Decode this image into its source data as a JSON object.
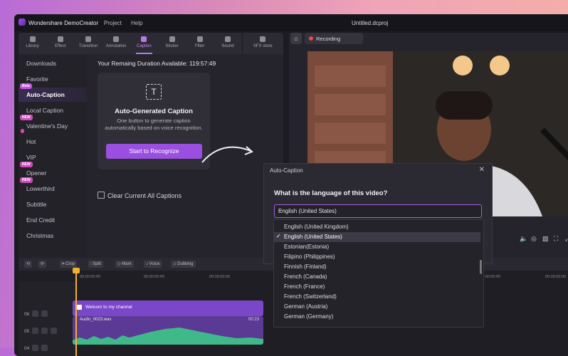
{
  "titlebar": {
    "brand": "Wondershare DemoCreator",
    "menu_project": "Project",
    "menu_help": "Help",
    "file": "Untitled.dcproj"
  },
  "tabs": [
    "Library",
    "Effect",
    "Transition",
    "Annotation",
    "Caption",
    "Sticker",
    "Filter",
    "Sound",
    "SFX store"
  ],
  "active_tab": "Caption",
  "sidebar": {
    "items": [
      {
        "label": "Downloads",
        "badge": ""
      },
      {
        "label": "Favorite",
        "badge": ""
      },
      {
        "label": "Auto-Caption",
        "badge": "Beta"
      },
      {
        "label": "Local Caption",
        "badge": ""
      },
      {
        "label": "Valentine's Day",
        "badge": "NEW"
      },
      {
        "label": "Hot",
        "badge": ""
      },
      {
        "label": "VIP",
        "badge": ""
      },
      {
        "label": "Opener",
        "badge": "NEW"
      },
      {
        "label": "Lowerthird",
        "badge": "NEW"
      },
      {
        "label": "Subtitle",
        "badge": ""
      },
      {
        "label": "End Credit",
        "badge": ""
      },
      {
        "label": "Christmas",
        "badge": ""
      }
    ]
  },
  "caption_panel": {
    "remaining": "Your Remaing Duration Available: 119:57:49",
    "card_title": "Auto-Generated Caption",
    "card_desc": "One button to generate caption automatically based on voice recognition.",
    "start_button": "Start to Recognize",
    "clear_label": "Clear Current All Captions"
  },
  "preview": {
    "recording_label": "Recording"
  },
  "dialog": {
    "title": "Auto-Caption",
    "question": "What is the language of this video?",
    "selected": "English (United States)",
    "options": [
      "English (United Kingdom)",
      "English (United States)",
      "Estonian(Estonia)",
      "Filipino (Philippines)",
      "Finnish (Finland)",
      "French (Canada)",
      "French (France)",
      "French (Switzerland)",
      "German (Austria)",
      "German (Germany)"
    ]
  },
  "timeline": {
    "tools": [
      "Crop",
      "Split",
      "Mark",
      "Voice",
      "Dubbing"
    ],
    "ruler": [
      "00:00:00:00",
      "00:00:00:00",
      "00:00:00:00",
      "00:00:00:00",
      "00:00:00:00"
    ],
    "tracks": [
      "06",
      "05",
      "04"
    ],
    "clip_title": "Welcom to my channel",
    "audio_clip": "Audio_0023.wav",
    "audio_time": "00:23"
  },
  "colors": {
    "accent": "#9a4fe0",
    "badge_new": "#d04ac0",
    "playhead": "#f0b22e"
  }
}
